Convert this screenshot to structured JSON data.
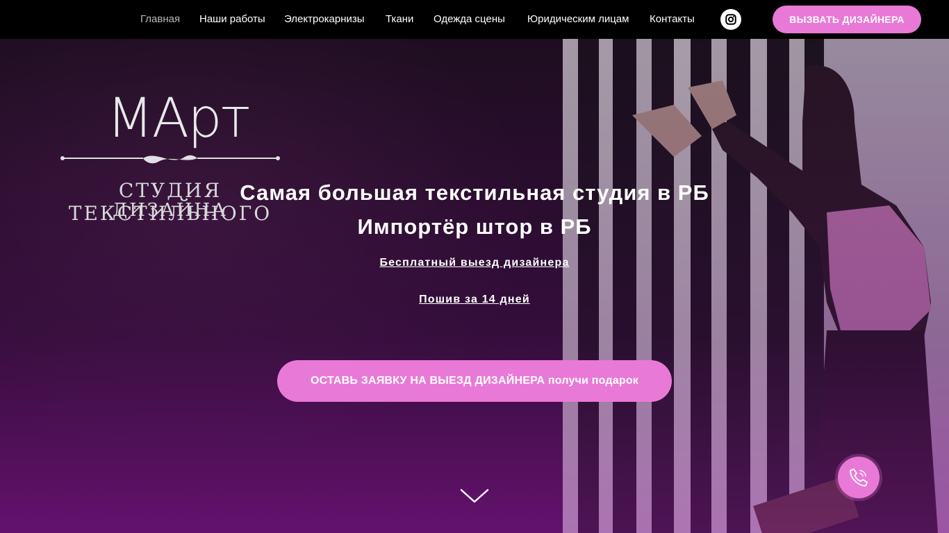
{
  "nav": {
    "items": [
      {
        "label": "Главная",
        "active": true
      },
      {
        "label": "Наши работы"
      },
      {
        "label": "Электрокарнизы"
      },
      {
        "label": "Ткани"
      },
      {
        "label": "Одежда сцены"
      },
      {
        "label": "Юридическим лицам"
      },
      {
        "label": "Контакты"
      }
    ],
    "social_icon": "instagram-icon",
    "call_designer_label": "ВЫЗВАТЬ ДИЗАЙНЕРА"
  },
  "logo": {
    "word": "МАрт",
    "line1": "СТУДИЯ ТЕКСТИЛЬНОГО",
    "line2": "ДИЗАЙНА"
  },
  "hero": {
    "headline_1": "Самая большая текстильная студия в РБ",
    "headline_2": "Импортёр штор в РБ",
    "link_1": "Бесплатный выезд дизайнера",
    "link_2": "Пошив за 14 дней",
    "cta_label": "ОСТАВЬ ЗАЯВКУ НА ВЫЕЗД ДИЗАЙНЕРА получи подарок",
    "scroll_icon": "chevron-down-icon",
    "phone_icon": "phone-icon"
  },
  "colors": {
    "accent": "#e979d6",
    "topbar": "#000000",
    "hero_dark": "#2c0f30"
  }
}
